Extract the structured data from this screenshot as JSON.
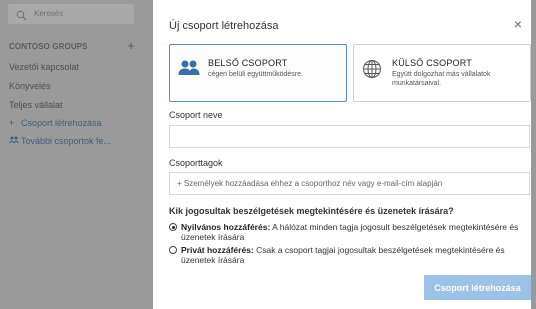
{
  "sidebar": {
    "search_placeholder": "Keresés",
    "groups_header": "CONTOSO GROUPS",
    "groups_add_symbol": "+",
    "items": [
      {
        "label": "Vezetői kapcsolat"
      },
      {
        "label": "Könyvelés"
      },
      {
        "label": "Teljes vállalat"
      },
      {
        "label": "Csoport létrehozása",
        "prefix": "+"
      },
      {
        "label": "További csoportok fe...",
        "prefix": "ὐ"
      }
    ]
  },
  "dialog": {
    "title": "Új csoport létrehozása",
    "close_symbol": "×",
    "internal": {
      "title": "BELSŐ CSOPORT",
      "desc": "cégen belüli együttműködésre.",
      "icon": "people-icon"
    },
    "external": {
      "title": "KÜLSŐ CSOPORT",
      "desc": "Együtt dolgozhat más vállalatok munkatársaival.",
      "icon": "globe-icon"
    },
    "name_label": "Csoport neve",
    "name_value": "",
    "members_label": "Csoporttagok",
    "members_placeholder": "+ Személyek hozzáadása ehhez a csoporthoz név vagy e-mail-cím alapján",
    "access_question": "Kik jogosultak beszélgetések megtekintésére és üzenetek írására?",
    "public_title": "Nyilvános hozzáférés:",
    "public_desc": " A hálózat minden tagja jogosult beszélgetések megtekintésére és üzenetek írására",
    "private_title": "Privát hozzáférés:",
    "private_desc": " Csak a csoport tagjai jogosultak beszélgetések megtekintésére és üzenetek írására",
    "selected_access": "public",
    "submit_label": "Csoport létrehozása"
  },
  "colors": {
    "accent": "#5b8fc7",
    "submit_disabled": "#9cc2e8",
    "overlay": "#9a9a9a"
  }
}
